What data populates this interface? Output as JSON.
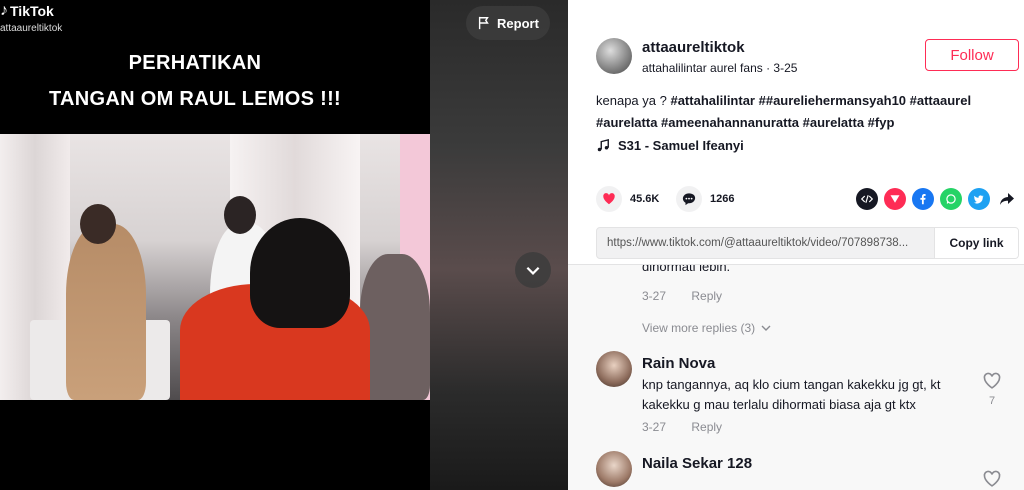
{
  "overlay": {
    "logo": "TikTok",
    "handle": "attaaureltiktok",
    "report_label": "Report"
  },
  "video": {
    "caption_line_1": "PERHATIKAN",
    "caption_line_2": "TANGAN OM RAUL LEMOS !!!"
  },
  "author": {
    "name": "attaaureltiktok",
    "subtitle": "attahalilintar aurel fans · 3-25",
    "follow_label": "Follow"
  },
  "post": {
    "description_plain": "kenapa ya ?",
    "hashtags_line_1": "#attahalilintar ##aureliehermansyah10 #attaaurel",
    "hashtags_line_2": "#aurelatta #ameenahannanuratta #aurelatta #fyp",
    "music": "S31 - Samuel Ifeanyi"
  },
  "actions": {
    "likes": "45.6K",
    "comments": "1266"
  },
  "link": {
    "url": "https://www.tiktok.com/@attaaureltiktok/video/707898738...",
    "copy_label": "Copy link"
  },
  "comments": {
    "truncated_text": "dihormati lebih.",
    "first_meta": {
      "date": "3-27",
      "reply": "Reply"
    },
    "view_more": "View more replies (3)",
    "items": [
      {
        "name": "Rain Nova",
        "text": "knp tangannya, aq klo cium tangan kakekku jg gt, kt kakekku g mau terlalu dihormati biasa aja gt ktx",
        "date": "3-27",
        "reply": "Reply",
        "likes": "7"
      },
      {
        "name": "Naila Sekar 128"
      }
    ]
  }
}
